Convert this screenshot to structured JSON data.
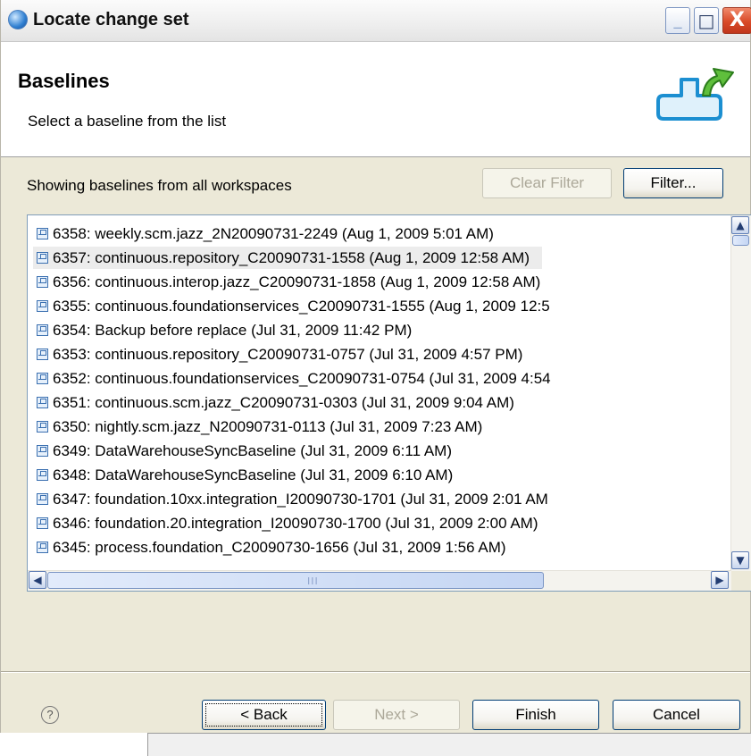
{
  "window": {
    "title": "Locate change set",
    "controls": {
      "minimize": "_",
      "maximize": "□",
      "close": "X"
    }
  },
  "banner": {
    "title": "Baselines",
    "description": "Select a baseline from the list",
    "icon": "baseline-wizard-icon"
  },
  "filter_row": {
    "label": "Showing baselines from all workspaces",
    "clear_filter_button": "Clear Filter",
    "filter_button": "Filter..."
  },
  "baselines": {
    "icon": "baseline-icon",
    "items": [
      "6358: weekly.scm.jazz_2N20090731-2249 (Aug 1, 2009 5:01 AM)",
      "6357: continuous.repository_C20090731-1558 (Aug 1, 2009 12:58 AM)",
      "6356: continuous.interop.jazz_C20090731-1858 (Aug 1, 2009 12:58 AM)",
      "6355: continuous.foundationservices_C20090731-1555 (Aug 1, 2009 12:5",
      "6354: Backup before replace (Jul 31, 2009 11:42 PM)",
      "6353: continuous.repository_C20090731-0757 (Jul 31, 2009 4:57 PM)",
      "6352: continuous.foundationservices_C20090731-0754 (Jul 31, 2009 4:54",
      "6351: continuous.scm.jazz_C20090731-0303 (Jul 31, 2009 9:04 AM)",
      "6350: nightly.scm.jazz_N20090731-0113 (Jul 31, 2009 7:23 AM)",
      "6349: DataWarehouseSyncBaseline (Jul 31, 2009 6:11 AM)",
      "6348: DataWarehouseSyncBaseline (Jul 31, 2009 6:10 AM)",
      "6347: foundation.10xx.integration_I20090730-1701 (Jul 31, 2009 2:01 AM",
      "6346: foundation.20.integration_I20090730-1700 (Jul 31, 2009 2:00 AM)",
      "6345: process.foundation_C20090730-1656 (Jul 31, 2009 1:56 AM)"
    ],
    "selected_index": 1,
    "scrollbar": {
      "up": "▲",
      "down": "▼",
      "left": "◀",
      "right": "▶",
      "grip": "III"
    }
  },
  "footer": {
    "help": "?",
    "back_button": "< Back",
    "next_button": "Next >",
    "finish_button": "Finish",
    "cancel_button": "Cancel"
  }
}
